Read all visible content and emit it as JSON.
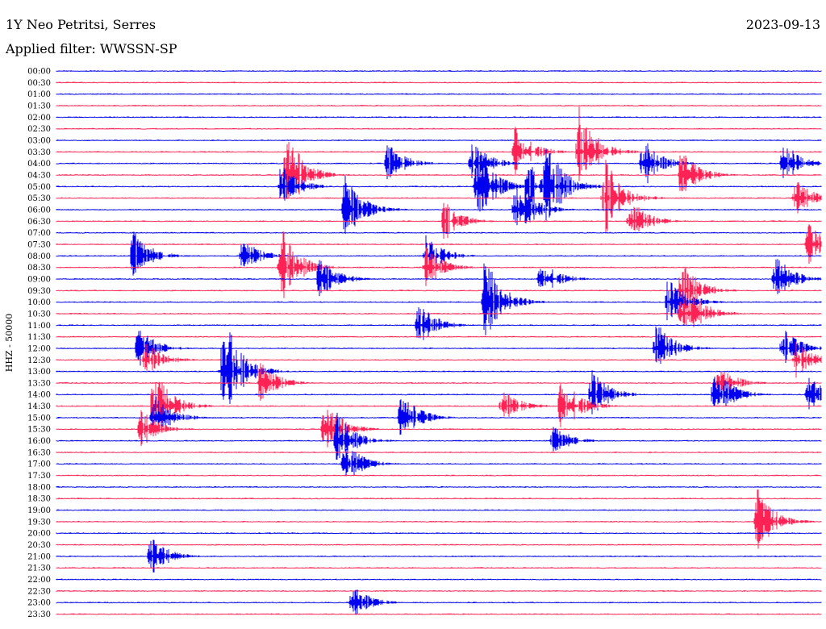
{
  "header": {
    "station": "1Y Neo Petritsi, Serres",
    "filter": "Applied filter: WWSSN-SP",
    "date": "2023-09-13"
  },
  "y_axis_side_label": "HHZ - 50000",
  "colors": {
    "even_row": "#0000ee",
    "odd_row": "#ff2255",
    "background": "#ffffff",
    "text": "#000000"
  },
  "chart_data": {
    "type": "helicorder",
    "rows": [
      "00:00",
      "00:30",
      "01:00",
      "01:30",
      "02:00",
      "02:30",
      "03:00",
      "03:30",
      "04:00",
      "04:30",
      "05:00",
      "05:30",
      "06:00",
      "06:30",
      "07:00",
      "07:30",
      "08:00",
      "08:30",
      "09:00",
      "09:30",
      "10:00",
      "10:30",
      "11:00",
      "11:30",
      "12:00",
      "12:30",
      "13:00",
      "13:30",
      "14:00",
      "14:30",
      "15:00",
      "15:30",
      "16:00",
      "16:30",
      "17:00",
      "17:30",
      "18:00",
      "18:30",
      "19:00",
      "19:30",
      "20:00",
      "20:30",
      "21:00",
      "21:30",
      "22:00",
      "22:30",
      "23:00",
      "23:30"
    ],
    "row_duration_minutes": 30,
    "events": [
      {
        "row": 9,
        "minute": 9.0,
        "amp": 1.0
      },
      {
        "row": 7,
        "minute": 18.0,
        "amp": 0.6
      },
      {
        "row": 7,
        "minute": 20.5,
        "amp": 1.0
      },
      {
        "row": 8,
        "minute": 23.0,
        "amp": 0.6
      },
      {
        "row": 9,
        "minute": 24.5,
        "amp": 0.55
      },
      {
        "row": 10,
        "minute": 19.2,
        "amp": 1.0
      },
      {
        "row": 10,
        "minute": 16.5,
        "amp": 0.9
      },
      {
        "row": 11,
        "minute": 21.5,
        "amp": 0.9
      },
      {
        "row": 12,
        "minute": 11.3,
        "amp": 0.85
      },
      {
        "row": 8,
        "minute": 28.5,
        "amp": 0.5
      },
      {
        "row": 10,
        "minute": 8.8,
        "amp": 0.5
      },
      {
        "row": 12,
        "minute": 18.2,
        "amp": 0.55
      },
      {
        "row": 13,
        "minute": 15.2,
        "amp": 0.45
      },
      {
        "row": 13,
        "minute": 22.5,
        "amp": 0.5
      },
      {
        "row": 16,
        "minute": 3.0,
        "amp": 0.55
      },
      {
        "row": 16,
        "minute": 7.3,
        "amp": 0.4
      },
      {
        "row": 17,
        "minute": 8.8,
        "amp": 0.9
      },
      {
        "row": 16,
        "minute": 14.5,
        "amp": 0.45
      },
      {
        "row": 18,
        "minute": 10.3,
        "amp": 0.5
      },
      {
        "row": 18,
        "minute": 28.2,
        "amp": 0.55
      },
      {
        "row": 19,
        "minute": 24.5,
        "amp": 0.7
      },
      {
        "row": 20,
        "minute": 16.8,
        "amp": 1.0
      },
      {
        "row": 22,
        "minute": 14.2,
        "amp": 0.5
      },
      {
        "row": 24,
        "minute": 3.2,
        "amp": 0.5
      },
      {
        "row": 25,
        "minute": 3.5,
        "amp": 0.4
      },
      {
        "row": 26,
        "minute": 6.5,
        "amp": 0.7
      },
      {
        "row": 26,
        "minute": 6.8,
        "amp": 0.85
      },
      {
        "row": 27,
        "minute": 8.0,
        "amp": 0.5
      },
      {
        "row": 28,
        "minute": 21.0,
        "amp": 0.55
      },
      {
        "row": 29,
        "minute": 19.8,
        "amp": 0.75
      },
      {
        "row": 29,
        "minute": 3.8,
        "amp": 0.85
      },
      {
        "row": 30,
        "minute": 3.8,
        "amp": 0.55
      },
      {
        "row": 30,
        "minute": 13.5,
        "amp": 0.6
      },
      {
        "row": 31,
        "minute": 10.5,
        "amp": 0.7
      },
      {
        "row": 31,
        "minute": 3.3,
        "amp": 0.45
      },
      {
        "row": 32,
        "minute": 11.0,
        "amp": 0.6
      },
      {
        "row": 34,
        "minute": 11.3,
        "amp": 0.5
      },
      {
        "row": 28,
        "minute": 26.0,
        "amp": 0.45
      },
      {
        "row": 25,
        "minute": 29.0,
        "amp": 0.4
      },
      {
        "row": 32,
        "minute": 19.5,
        "amp": 0.35
      },
      {
        "row": 39,
        "minute": 27.5,
        "amp": 0.7
      },
      {
        "row": 42,
        "minute": 3.7,
        "amp": 0.45
      },
      {
        "row": 46,
        "minute": 11.6,
        "amp": 0.4
      },
      {
        "row": 8,
        "minute": 13.0,
        "amp": 0.45
      },
      {
        "row": 8,
        "minute": 16.3,
        "amp": 0.5
      },
      {
        "row": 10,
        "minute": 18.5,
        "amp": 0.6
      },
      {
        "row": 12,
        "minute": 18.0,
        "amp": 0.5
      },
      {
        "row": 15,
        "minute": 29.5,
        "amp": 0.45
      },
      {
        "row": 11,
        "minute": 29.0,
        "amp": 0.4
      },
      {
        "row": 28,
        "minute": 25.8,
        "amp": 0.5
      },
      {
        "row": 28,
        "minute": 29.5,
        "amp": 0.4
      },
      {
        "row": 21,
        "minute": 25.0,
        "amp": 0.45
      },
      {
        "row": 24,
        "minute": 28.5,
        "amp": 0.45
      },
      {
        "row": 17,
        "minute": 14.5,
        "amp": 0.45
      },
      {
        "row": 18,
        "minute": 19.0,
        "amp": 0.45
      },
      {
        "row": 20,
        "minute": 24.0,
        "amp": 0.6
      },
      {
        "row": 21,
        "minute": 24.5,
        "amp": 0.5
      },
      {
        "row": 24,
        "minute": 23.5,
        "amp": 0.6
      },
      {
        "row": 27,
        "minute": 26.0,
        "amp": 0.4
      },
      {
        "row": 29,
        "minute": 17.5,
        "amp": 0.4
      }
    ]
  }
}
